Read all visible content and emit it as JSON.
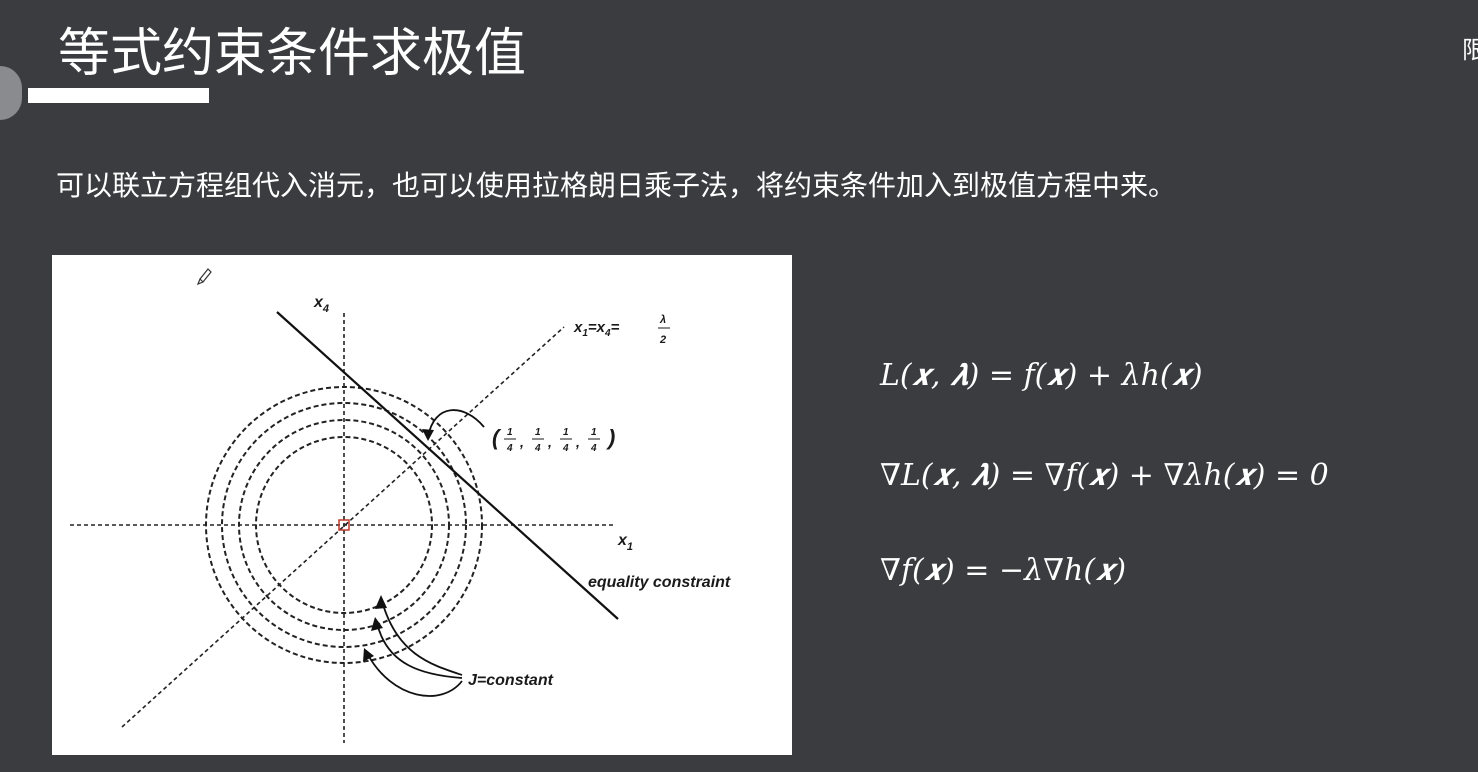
{
  "slide": {
    "title": "等式约束条件求极值",
    "corner_glyph": "限",
    "subtitle": "可以联立方程组代入消元，也可以使用拉格朗日乘子法，将约束条件加入到极值方程中来。"
  },
  "figure": {
    "x_axis_label": "x",
    "x_axis_sub": "1",
    "y_axis_label": "x",
    "y_axis_sub": "4",
    "diagonal_label": "x",
    "diagonal_sub1": "1",
    "diagonal_eq": "=x",
    "diagonal_sub4": "4",
    "diagonal_eq2": "=",
    "lambda_num": "λ",
    "lambda_den": "2",
    "point_open": "(",
    "point_num": "1",
    "point_den": "4",
    "point_comma": ",",
    "point_close": ")",
    "equality_label": "equality constraint",
    "contour_label": "J=constant"
  },
  "equations": {
    "eq1": "L(𝒙, 𝝀) = f(𝒙) + λh(𝒙)",
    "eq2": "∇L(𝒙, 𝝀) = ∇f(𝒙) + ∇λh(𝒙) = 0",
    "eq3": "∇f(𝒙) = −λ∇h(𝒙)"
  }
}
